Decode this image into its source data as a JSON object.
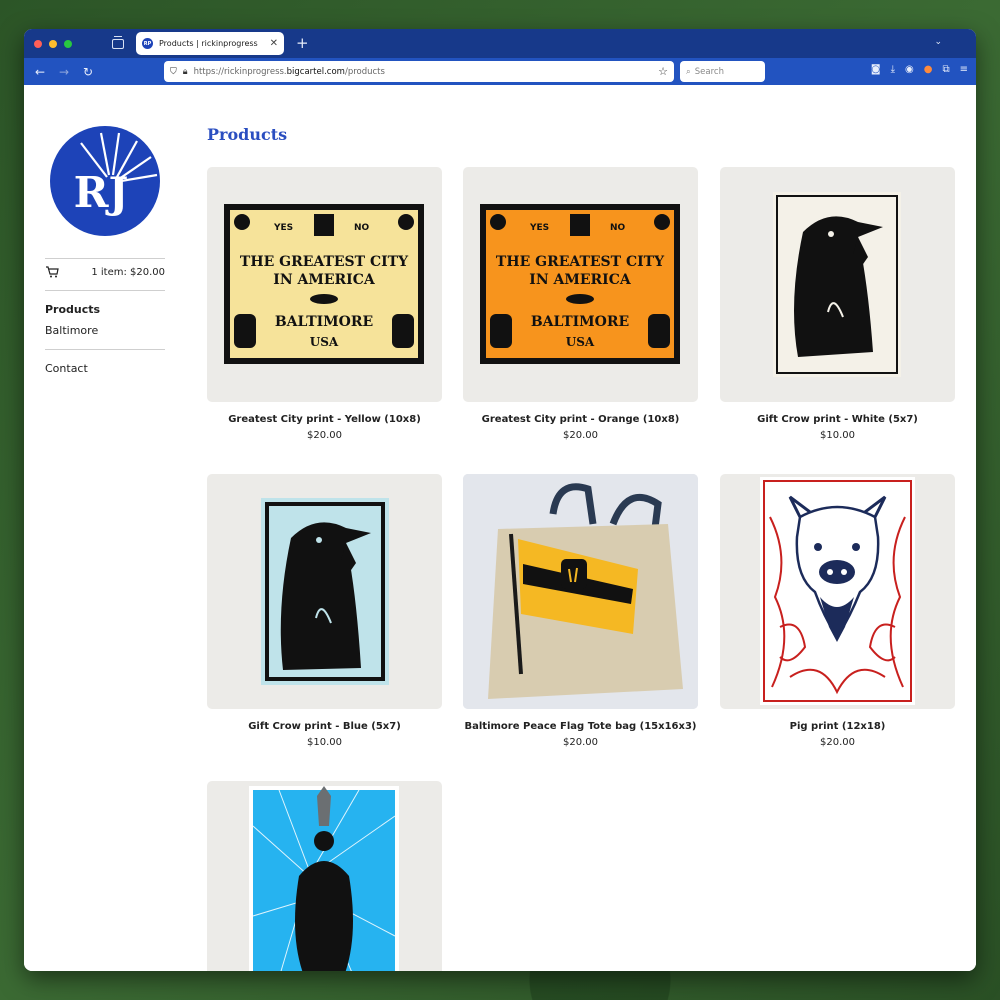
{
  "browser": {
    "tab_title": "Products | rickinprogress",
    "tab_favicon_text": "RP",
    "new_tab": "+",
    "tab_close": "✕",
    "url_prefix": "https://rickinprogress.",
    "url_domain": "bigcartel.com",
    "url_path": "/products",
    "search_placeholder": "Search"
  },
  "sidebar": {
    "logo_letters": "RJ",
    "cart_summary": "1 item: $20.00",
    "nav": [
      "Products",
      "Baltimore"
    ],
    "contact": "Contact"
  },
  "main": {
    "title": "Products",
    "products": [
      {
        "name": "Greatest City print - Yellow (10x8)",
        "price": "$20.00"
      },
      {
        "name": "Greatest City print - Orange (10x8)",
        "price": "$20.00"
      },
      {
        "name": "Gift Crow print - White (5x7)",
        "price": "$10.00"
      },
      {
        "name": "Gift Crow print - Blue (5x7)",
        "price": "$10.00"
      },
      {
        "name": "Baltimore Peace Flag Tote bag (15x16x3)",
        "price": "$20.00"
      },
      {
        "name": "Pig print (12x18)",
        "price": "$20.00"
      }
    ],
    "poster_text": {
      "yes": "YES",
      "no": "NO",
      "line1": "THE GREATEST CITY",
      "line2": "IN AMERICA",
      "city": "BALTIMORE",
      "country": "USA"
    }
  },
  "colors": {
    "accent_blue": "#2a4ec0",
    "browser_tab_bar": "#17398a",
    "browser_nav_bar": "#2253c0",
    "poster_yellow": "#f6e39a",
    "poster_orange": "#f7941d",
    "crow_blue_bg": "#bfe3ea",
    "raven_bg": "#26b3f0",
    "pig_red": "#c8201e"
  }
}
